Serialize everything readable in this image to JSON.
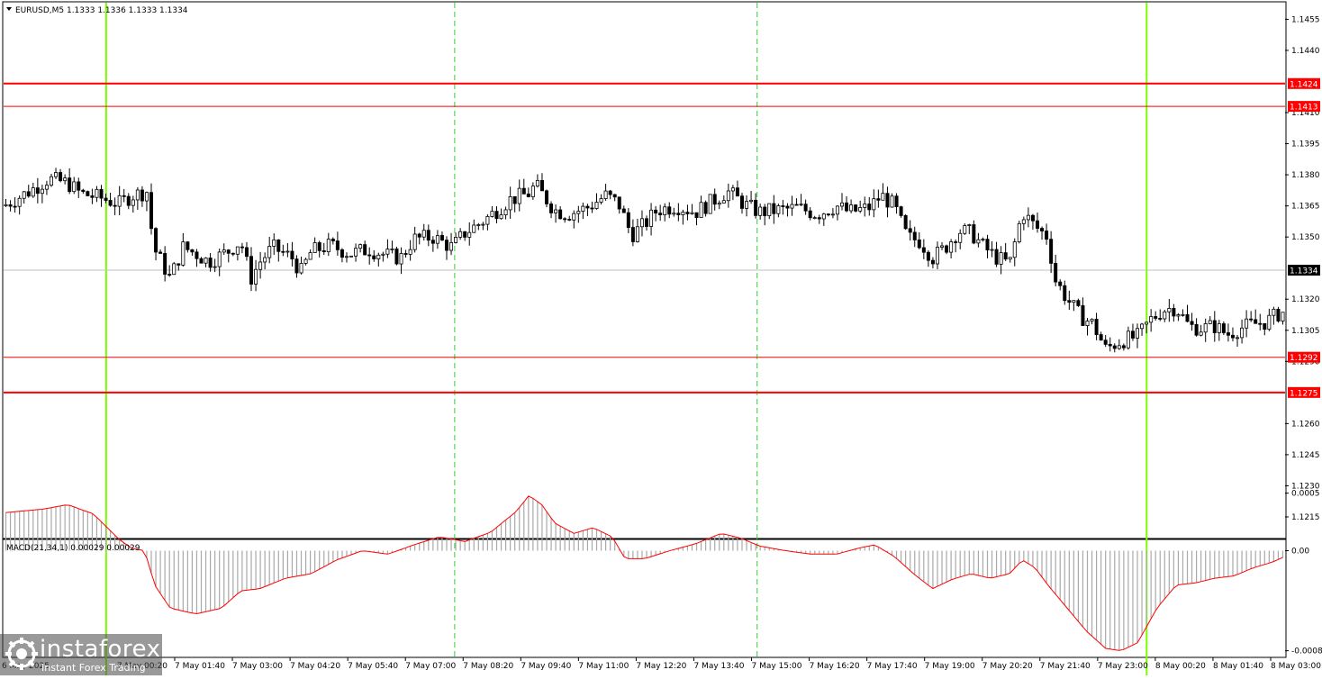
{
  "symbol_title": "EURUSD,M5  1.1333 1.1336 1.1333 1.1334",
  "indicator_title": "MACD(21,34,1) 0.00029 0.00029",
  "watermark": {
    "brand": "instaforex",
    "tagline": "Instant Forex Trading",
    "logo_icon": "instaforex-logo-icon"
  },
  "colors": {
    "background": "#ffffff",
    "axis_text": "#000000",
    "grid_dashed_green": "#32cd32",
    "session_green": "#7cfc00",
    "level_red": "#ff0000",
    "current_price_line": "#c0c0c0",
    "macd_histogram": "#a9a9a9",
    "macd_signal": "#ff0000"
  },
  "chart_data": [
    {
      "type": "candlestick",
      "title": "EURUSD,M5",
      "ylim": [
        1.1205,
        1.1463
      ],
      "y_ticks": [
        "1.1455",
        "1.1440",
        "1.1410",
        "1.1395",
        "1.1380",
        "1.1365",
        "1.1350",
        "1.1320",
        "1.1305",
        "1.1290",
        "1.1260",
        "1.1245",
        "1.1230",
        "1.1215"
      ],
      "x_ticks": [
        "7 May 01:40",
        "7 May 03:00",
        "7 May 04:20",
        "7 May 05:40",
        "7 May 07:00",
        "7 May 08:20",
        "7 May 09:40",
        "7 May 11:00",
        "7 May 12:20",
        "7 May 13:40",
        "7 May 15:00",
        "7 May 16:20",
        "7 May 17:40",
        "7 May 19:00",
        "7 May 20:20",
        "7 May 21:40",
        "7 May 23:00",
        "8 May 00:20",
        "8 May 01:40",
        "8 May 03:00"
      ],
      "x_tick_partial": "6 May 2025",
      "x_tick_partial_2": "7 May 00:20",
      "price_levels": [
        {
          "label": "1.1424",
          "value": 1.1424,
          "style": "thick"
        },
        {
          "label": "1.1413",
          "value": 1.1413,
          "style": "thin"
        },
        {
          "label": "1.1292",
          "value": 1.1292,
          "style": "thin"
        },
        {
          "label": "1.1275",
          "value": 1.1275,
          "style": "thick"
        }
      ],
      "current_price": {
        "label": "1.1334",
        "value": 1.1334
      },
      "session_lines_solid": [
        0.08,
        0.892
      ],
      "session_lines_dashed": [
        0.352,
        0.588
      ],
      "close_path": [
        [
          0.0,
          1.1365
        ],
        [
          0.02,
          1.1372
        ],
        [
          0.035,
          1.1378
        ],
        [
          0.05,
          1.1376
        ],
        [
          0.06,
          1.1371
        ],
        [
          0.075,
          1.1369
        ],
        [
          0.09,
          1.1366
        ],
        [
          0.1,
          1.137
        ],
        [
          0.112,
          1.1372
        ],
        [
          0.117,
          1.1345
        ],
        [
          0.124,
          1.1337
        ],
        [
          0.13,
          1.133
        ],
        [
          0.14,
          1.1345
        ],
        [
          0.15,
          1.1342
        ],
        [
          0.16,
          1.1338
        ],
        [
          0.175,
          1.1343
        ],
        [
          0.185,
          1.1348
        ],
        [
          0.193,
          1.133
        ],
        [
          0.2,
          1.1338
        ],
        [
          0.21,
          1.1345
        ],
        [
          0.225,
          1.134
        ],
        [
          0.232,
          1.1333
        ],
        [
          0.24,
          1.1343
        ],
        [
          0.255,
          1.1346
        ],
        [
          0.27,
          1.1342
        ],
        [
          0.285,
          1.1344
        ],
        [
          0.3,
          1.1341
        ],
        [
          0.31,
          1.134
        ],
        [
          0.32,
          1.1349
        ],
        [
          0.335,
          1.135
        ],
        [
          0.35,
          1.1345
        ],
        [
          0.36,
          1.1352
        ],
        [
          0.375,
          1.1358
        ],
        [
          0.385,
          1.1363
        ],
        [
          0.395,
          1.1368
        ],
        [
          0.41,
          1.1371
        ],
        [
          0.415,
          1.1375
        ],
        [
          0.43,
          1.1363
        ],
        [
          0.44,
          1.1361
        ],
        [
          0.455,
          1.1364
        ],
        [
          0.47,
          1.137
        ],
        [
          0.48,
          1.1366
        ],
        [
          0.49,
          1.1351
        ],
        [
          0.5,
          1.1356
        ],
        [
          0.51,
          1.1363
        ],
        [
          0.525,
          1.1365
        ],
        [
          0.54,
          1.1362
        ],
        [
          0.55,
          1.1366
        ],
        [
          0.565,
          1.1372
        ],
        [
          0.58,
          1.1365
        ],
        [
          0.59,
          1.1362
        ],
        [
          0.605,
          1.1363
        ],
        [
          0.62,
          1.1364
        ],
        [
          0.635,
          1.1361
        ],
        [
          0.65,
          1.1365
        ],
        [
          0.66,
          1.1362
        ],
        [
          0.675,
          1.1364
        ],
        [
          0.685,
          1.137
        ],
        [
          0.695,
          1.1365
        ],
        [
          0.705,
          1.135
        ],
        [
          0.715,
          1.1348
        ],
        [
          0.725,
          1.134
        ],
        [
          0.735,
          1.1345
        ],
        [
          0.745,
          1.1353
        ],
        [
          0.755,
          1.1352
        ],
        [
          0.765,
          1.1345
        ],
        [
          0.775,
          1.134
        ],
        [
          0.785,
          1.1337
        ],
        [
          0.795,
          1.1362
        ],
        [
          0.805,
          1.1355
        ],
        [
          0.815,
          1.135
        ],
        [
          0.82,
          1.133
        ],
        [
          0.83,
          1.132
        ],
        [
          0.84,
          1.1312
        ],
        [
          0.85,
          1.1308
        ],
        [
          0.86,
          1.1296
        ],
        [
          0.872,
          1.13
        ],
        [
          0.885,
          1.1302
        ],
        [
          0.895,
          1.131
        ],
        [
          0.905,
          1.1315
        ],
        [
          0.915,
          1.1316
        ],
        [
          0.925,
          1.1307
        ],
        [
          0.935,
          1.1306
        ],
        [
          0.945,
          1.1307
        ],
        [
          0.955,
          1.1303
        ],
        [
          0.965,
          1.1306
        ],
        [
          0.975,
          1.1308
        ],
        [
          0.985,
          1.1309
        ],
        [
          0.995,
          1.1313
        ],
        [
          1.0,
          1.1314
        ]
      ]
    },
    {
      "type": "histogram",
      "title": "MACD(21,34,1)",
      "ylim": [
        -0.00092,
        9e-05
      ],
      "y_ticks": [
        "0.0005",
        "0.00",
        "-0.00087"
      ],
      "series": [
        {
          "name": "MACD",
          "kind": "bar",
          "color": "#a9a9a9",
          "values_path": [
            [
              0.0,
              0.00033
            ],
            [
              0.03,
              0.00036
            ],
            [
              0.05,
              0.0004
            ],
            [
              0.07,
              0.00032
            ],
            [
              0.09,
              0.0001
            ],
            [
              0.1,
              2e-05
            ],
            [
              0.11,
              0.0
            ],
            [
              0.118,
              -0.0003
            ],
            [
              0.13,
              -0.0005
            ],
            [
              0.15,
              -0.00055
            ],
            [
              0.17,
              -0.0005
            ],
            [
              0.185,
              -0.00035
            ],
            [
              0.2,
              -0.00033
            ],
            [
              0.22,
              -0.00024
            ],
            [
              0.24,
              -0.0002
            ],
            [
              0.26,
              -8e-05
            ],
            [
              0.28,
              0.0
            ],
            [
              0.3,
              -3e-05
            ],
            [
              0.32,
              5e-05
            ],
            [
              0.34,
              0.00012
            ],
            [
              0.36,
              8e-05
            ],
            [
              0.38,
              0.00016
            ],
            [
              0.4,
              0.00034
            ],
            [
              0.41,
              0.00048
            ],
            [
              0.42,
              0.0004
            ],
            [
              0.43,
              0.00024
            ],
            [
              0.445,
              0.00015
            ],
            [
              0.46,
              0.0002
            ],
            [
              0.475,
              0.00012
            ],
            [
              0.485,
              -7e-05
            ],
            [
              0.5,
              -7e-05
            ],
            [
              0.52,
              0.0
            ],
            [
              0.54,
              6e-05
            ],
            [
              0.56,
              0.00015
            ],
            [
              0.575,
              0.00011
            ],
            [
              0.59,
              4e-05
            ],
            [
              0.61,
              0.0
            ],
            [
              0.63,
              -3e-05
            ],
            [
              0.65,
              -3e-05
            ],
            [
              0.67,
              3e-05
            ],
            [
              0.68,
              5e-05
            ],
            [
              0.695,
              -5e-05
            ],
            [
              0.71,
              -0.0002
            ],
            [
              0.725,
              -0.00033
            ],
            [
              0.74,
              -0.00025
            ],
            [
              0.755,
              -0.0002
            ],
            [
              0.77,
              -0.00024
            ],
            [
              0.785,
              -0.0002
            ],
            [
              0.795,
              -8e-05
            ],
            [
              0.805,
              -0.00015
            ],
            [
              0.815,
              -0.0003
            ],
            [
              0.83,
              -0.0005
            ],
            [
              0.845,
              -0.0007
            ],
            [
              0.86,
              -0.00085
            ],
            [
              0.872,
              -0.00087
            ],
            [
              0.885,
              -0.0008
            ],
            [
              0.9,
              -0.0005
            ],
            [
              0.915,
              -0.0003
            ],
            [
              0.93,
              -0.00028
            ],
            [
              0.945,
              -0.00024
            ],
            [
              0.96,
              -0.00022
            ],
            [
              0.975,
              -0.00015
            ],
            [
              0.99,
              -0.0001
            ],
            [
              1.0,
              -5e-05
            ]
          ]
        },
        {
          "name": "Signal",
          "kind": "line",
          "color": "#ff0000",
          "note": "signal period 1 (overlaps MACD)"
        }
      ]
    }
  ]
}
